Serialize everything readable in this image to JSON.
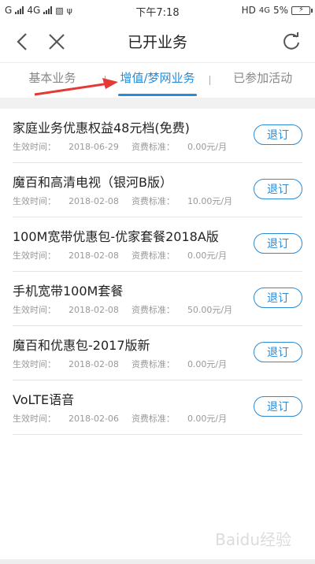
{
  "status_bar": {
    "carrier_left": "G",
    "carrier_4g": "4G",
    "time": "下午7:18",
    "hd": "HD",
    "net": "4G",
    "battery": "5%"
  },
  "header": {
    "title": "已开业务"
  },
  "tabs": [
    {
      "label": "基本业务",
      "active": false
    },
    {
      "label": "增值/梦网业务",
      "active": true
    },
    {
      "label": "已参加活动",
      "active": false
    }
  ],
  "labels": {
    "effective": "生效时间：",
    "fee": "资费标准："
  },
  "items": [
    {
      "name": "家庭业务优惠权益48元档(免费)",
      "date": "2018-06-29",
      "fee": "0.00元/月",
      "button": "退订"
    },
    {
      "name": "魔百和高清电视（银河B版）",
      "date": "2018-02-08",
      "fee": "10.00元/月",
      "button": "退订"
    },
    {
      "name": "100M宽带优惠包-优家套餐2018A版",
      "date": "2018-02-08",
      "fee": "0.00元/月",
      "button": "退订"
    },
    {
      "name": "手机宽带100M套餐",
      "date": "2018-02-08",
      "fee": "50.00元/月",
      "button": "退订"
    },
    {
      "name": "魔百和优惠包-2017版新",
      "date": "2018-02-08",
      "fee": "0.00元/月",
      "button": "退订"
    },
    {
      "name": "VoLTE语音",
      "date": "2018-02-06",
      "fee": "0.00元/月",
      "button": "退订"
    }
  ],
  "watermark": "Baidu经验",
  "colors": {
    "accent": "#2a8bd6",
    "arrow": "#e53935"
  }
}
